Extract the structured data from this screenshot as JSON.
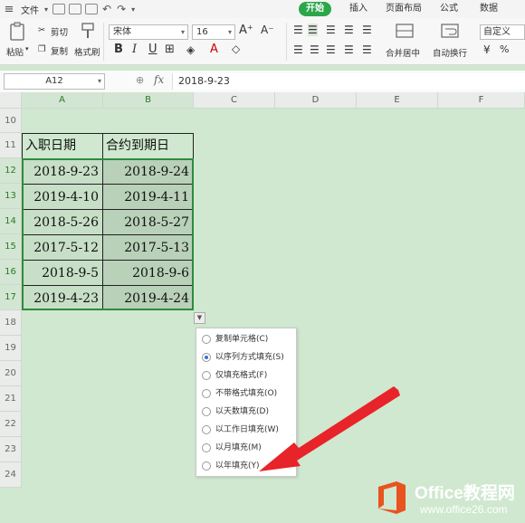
{
  "menubar": {
    "file_label": "文件",
    "tabs": [
      "开始",
      "插入",
      "页面布局",
      "公式",
      "数据"
    ]
  },
  "ribbon": {
    "paste_label": "粘贴",
    "cut_label": "剪切",
    "copy_label": "复制",
    "format_painter_label": "格式刷",
    "font_name": "宋体",
    "font_size": "16",
    "bold": "B",
    "italic": "I",
    "underline": "U",
    "merge_center_label": "合并居中",
    "wrap_text_label": "自动换行",
    "number_format": "自定义"
  },
  "formula_bar": {
    "name_box": "A12",
    "fx": "fx",
    "value": "2018-9-23"
  },
  "sheet": {
    "columns": [
      "A",
      "B",
      "C",
      "D",
      "E",
      "F"
    ],
    "rows": [
      "10",
      "11",
      "12",
      "13",
      "14",
      "15",
      "16",
      "17",
      "18",
      "19",
      "20",
      "21",
      "22",
      "23",
      "24"
    ],
    "headers": [
      "入职日期",
      "合约到期日"
    ],
    "data": [
      [
        "2018-9-23",
        "2018-9-24"
      ],
      [
        "2019-4-10",
        "2019-4-11"
      ],
      [
        "2018-5-26",
        "2018-5-27"
      ],
      [
        "2017-5-12",
        "2017-5-13"
      ],
      [
        "2018-9-5",
        "2018-9-6"
      ],
      [
        "2019-4-23",
        "2019-4-24"
      ]
    ]
  },
  "autofill_menu": {
    "options": [
      {
        "label": "复制单元格(C)",
        "selected": false
      },
      {
        "label": "以序列方式填充(S)",
        "selected": true
      },
      {
        "label": "仅填充格式(F)",
        "selected": false
      },
      {
        "label": "不带格式填充(O)",
        "selected": false
      },
      {
        "label": "以天数填充(D)",
        "selected": false
      },
      {
        "label": "以工作日填充(W)",
        "selected": false
      },
      {
        "label": "以月填充(M)",
        "selected": false
      },
      {
        "label": "以年填充(Y)",
        "selected": false
      }
    ]
  },
  "watermark": {
    "title": "Office教程网",
    "url": "www.office26.com"
  },
  "colors": {
    "accent": "#2ca64a",
    "sheet_bg": "#cfe8cf",
    "arrow": "#e8232a"
  }
}
